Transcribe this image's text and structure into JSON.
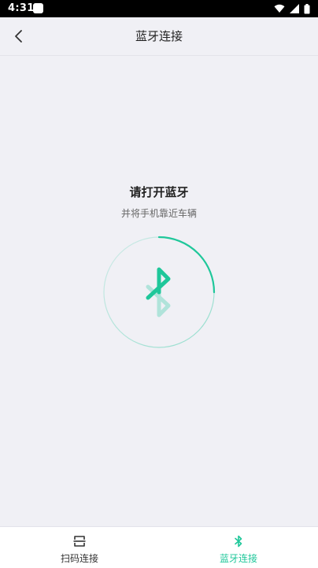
{
  "status_bar": {
    "time": "4:31"
  },
  "header": {
    "title": "蓝牙连接",
    "back_icon": "chevron-left-icon"
  },
  "main": {
    "prompt_title": "请打开蓝牙",
    "prompt_subtitle": "并将手机靠近车辆",
    "center_icon": "bluetooth-icon",
    "accent_color": "#1fc79a"
  },
  "bottom_nav": {
    "items": [
      {
        "label": "扫码连接",
        "icon": "scan-icon",
        "active": false
      },
      {
        "label": "蓝牙连接",
        "icon": "bluetooth-icon",
        "active": true
      }
    ],
    "active_color": "#1fc79a"
  }
}
